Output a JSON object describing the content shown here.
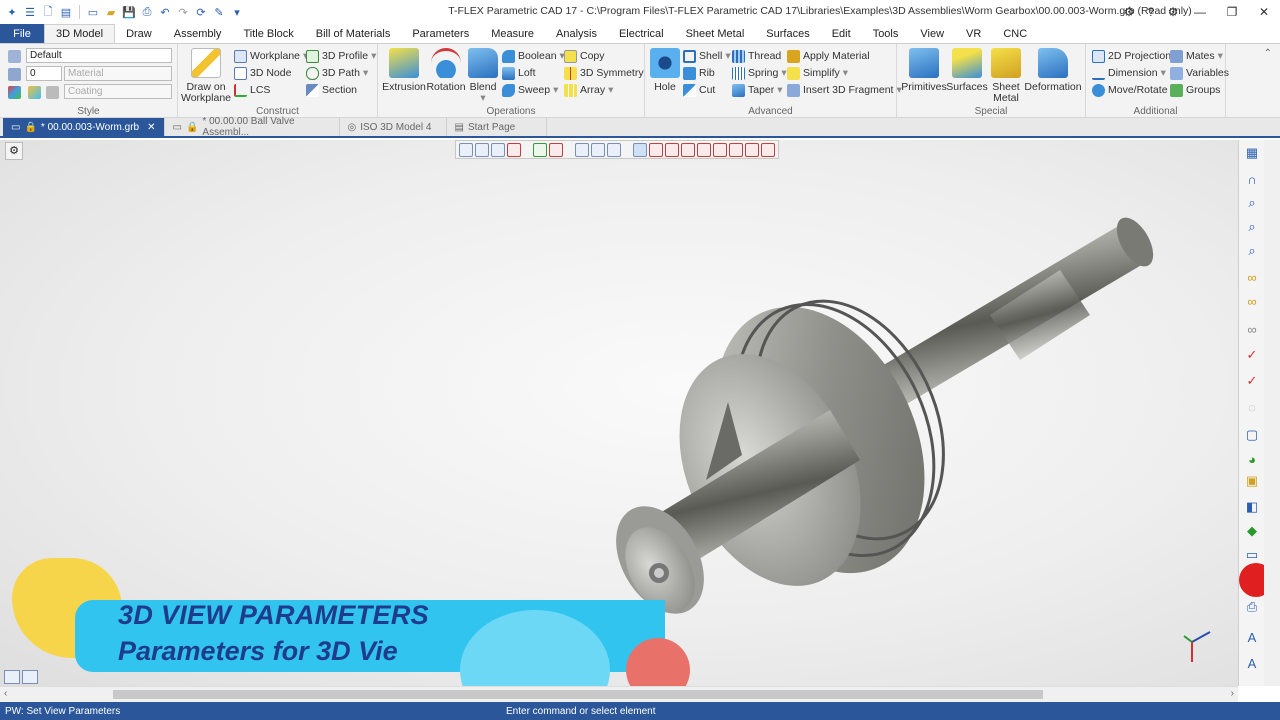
{
  "window": {
    "title": "T-FLEX Parametric CAD 17 - C:\\Program Files\\T-FLEX Parametric CAD 17\\Libraries\\Examples\\3D Assemblies\\Worm Gearbox\\00.00.003-Worm.grb (Read only)"
  },
  "menu": {
    "file": "File",
    "tabs": [
      "3D Model",
      "Draw",
      "Assembly",
      "Title Block",
      "Bill of Materials",
      "Parameters",
      "Measure",
      "Analysis",
      "Electrical",
      "Sheet Metal",
      "Surfaces",
      "Edit",
      "Tools",
      "View",
      "VR",
      "CNC"
    ]
  },
  "ribbon": {
    "style": {
      "label": "Style",
      "layer": "Default",
      "level": "0",
      "material": "Material",
      "coating": "Coating"
    },
    "draw": {
      "label": "Draw on Workplane"
    },
    "construct": {
      "label": "Construct",
      "workplane": "Workplane",
      "node": "3D Node",
      "lcs": "LCS",
      "profile": "3D Profile",
      "path": "3D Path",
      "section": "Section"
    },
    "operations": {
      "label": "Operations",
      "extrusion": "Extrusion",
      "rotation": "Rotation",
      "blend": "Blend",
      "boolean": "Boolean",
      "loft": "Loft",
      "sweep": "Sweep",
      "copy": "Copy",
      "symmetry": "3D Symmetry",
      "array": "Array"
    },
    "advanced": {
      "label": "Advanced",
      "hole": "Hole",
      "shell": "Shell",
      "rib": "Rib",
      "cut": "Cut",
      "thread": "Thread",
      "spring": "Spring",
      "taper": "Taper",
      "apply_material": "Apply Material",
      "simplify": "Simplify",
      "insert_fragment": "Insert 3D Fragment"
    },
    "special": {
      "label": "Special",
      "primitives": "Primitives",
      "surfaces": "Surfaces",
      "sheet_metal": "Sheet Metal",
      "deformation": "Deformation"
    },
    "additional": {
      "label": "Additional",
      "projection": "2D Projection",
      "dimension": "Dimension",
      "move_rotate": "Move/Rotate",
      "mates": "Mates",
      "variables": "Variables",
      "groups": "Groups"
    }
  },
  "doc_tabs": [
    {
      "label": "* 00.00.003-Worm.grb"
    },
    {
      "label": "* 00.00.00 Ball Valve Assembl..."
    },
    {
      "label": "ISO 3D Model 4"
    },
    {
      "label": "Start Page"
    }
  ],
  "overlay": {
    "title": "3D VIEW PARAMETERS",
    "subtitle": "Parameters for 3D Vie"
  },
  "status": {
    "left": "PW: Set View Parameters",
    "center": "Enter command or select element"
  },
  "colors": {
    "accent": "#2b579a",
    "overlay_blue": "#31c4ef",
    "overlay_yellow": "#f7d54a",
    "overlay_red": "#e8716a"
  }
}
